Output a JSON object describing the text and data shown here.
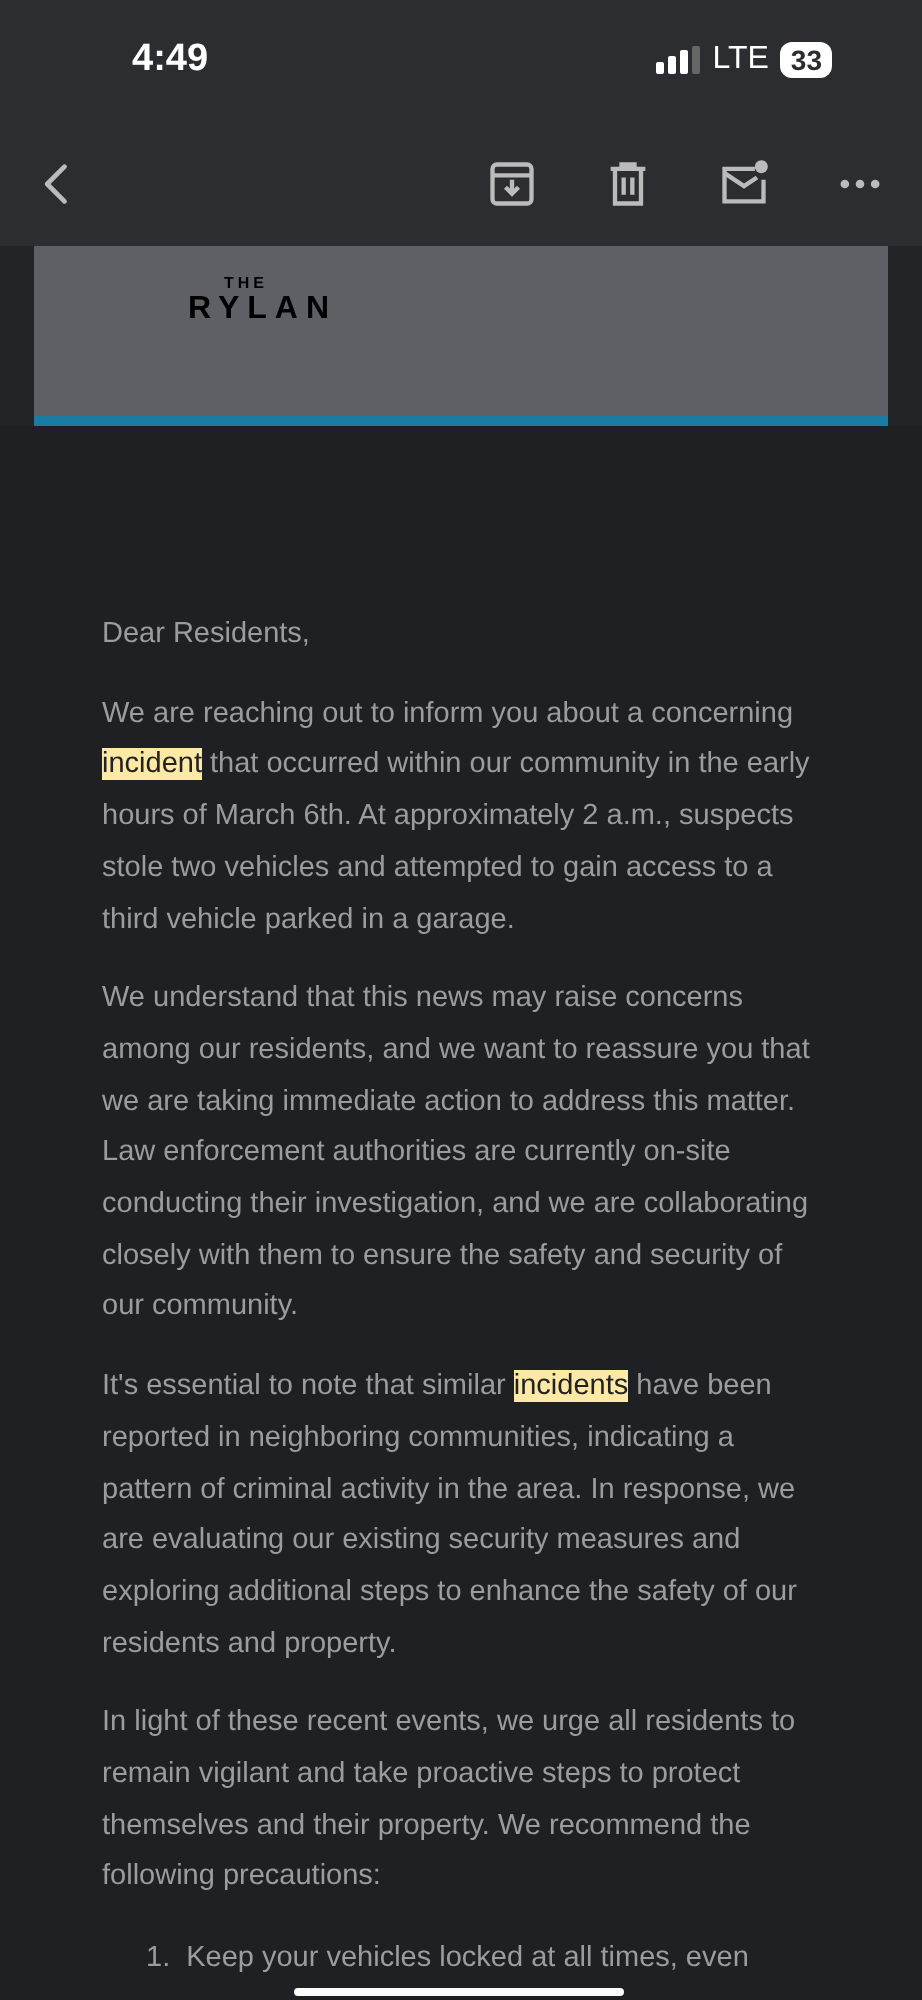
{
  "status_bar": {
    "time": "4:49",
    "network": "LTE",
    "battery": "33"
  },
  "toolbar": {
    "actions": [
      {
        "kind": "back"
      },
      {
        "kind": "archive"
      },
      {
        "kind": "delete"
      },
      {
        "kind": "mark-unread"
      },
      {
        "kind": "more"
      }
    ]
  },
  "header": {
    "logo_small": "THE",
    "logo": "RYLAN"
  },
  "body": {
    "greeting": "Dear Residents,",
    "paragraphs": [
      [
        {
          "text": "We are reaching out to inform you about a concerning ",
          "highlighted": false
        },
        {
          "text": "incident",
          "highlighted": true
        },
        {
          "text": " that occurred within our community in the early hours of March 6th. At approximately 2 a.m., suspects stole two vehicles and attempted to gain access to a third vehicle parked in a garage.",
          "highlighted": false
        }
      ],
      [
        {
          "text": "We understand that this news may raise concerns among our residents, and we want to reassure you that we are taking immediate action to address this matter. Law enforcement authorities are currently on-site conducting their investigation, and we are collaborating closely with them to ensure the safety and security of our community.",
          "highlighted": false
        }
      ],
      [
        {
          "text": "It's essential to note that similar ",
          "highlighted": false
        },
        {
          "text": "incidents",
          "highlighted": true
        },
        {
          "text": " have been reported in neighboring communities, indicating a pattern of criminal activity in the area. In response, we are evaluating our existing security measures and exploring additional steps to enhance the safety of our residents and property.",
          "highlighted": false
        }
      ],
      [
        {
          "text": "In light of these recent events, we urge all residents to remain vigilant and take proactive steps to protect themselves and their property. We recommend the following precautions:",
          "highlighted": false
        }
      ]
    ],
    "list": [
      {
        "number": "1.",
        "text": "Keep your vehicles locked at all times, even"
      }
    ]
  }
}
